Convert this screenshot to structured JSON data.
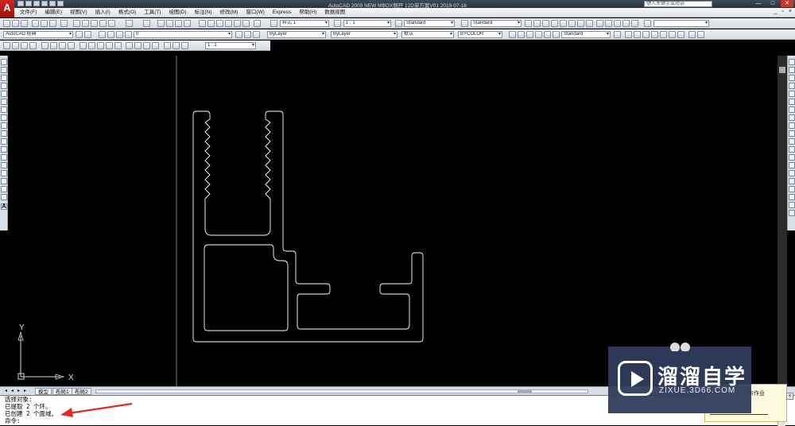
{
  "title_bar": {
    "window_title": "AutoCAD 2009  NEW MBOX侧开 12D单方案V01 2019-07-16",
    "search_placeholder": "键入关键字或短语",
    "minimize": "—",
    "maximize": "□",
    "close": "✕"
  },
  "menu": {
    "items": [
      "文件(F)",
      "编辑(E)",
      "视图(V)",
      "插入(I)",
      "格式(O)",
      "工具(T)",
      "绘图(D)",
      "标注(N)",
      "修改(M)",
      "窗口(W)",
      "Express",
      "帮助(H)",
      "数据视图"
    ],
    "mdi_minimize": "_",
    "mdi_restore": "▫",
    "mdi_close": "×"
  },
  "toolbars": {
    "dim_style": "样式 1",
    "scale": "1 : 1",
    "text_style": "Standard",
    "table_style": "Standard",
    "workspace": "AutoCAD 经典",
    "layer": "0",
    "color": "ByLayer",
    "linetype": "ByLayer",
    "lineweight": "默认",
    "plot_style": "BYCOLOR",
    "multileader_style": "Standard",
    "viewport_scale": "1 : 1"
  },
  "ucs": {
    "x_label": "X",
    "y_label": "Y"
  },
  "layout_tabs": {
    "model": "模型",
    "layout1": "布局1",
    "layout2": "布局2"
  },
  "command_line": {
    "lines": [
      "选择对象:",
      "已提取 2 个环。",
      "已创建 2 个面域。",
      "命令:"
    ]
  },
  "notification": {
    "title": "布作业",
    "link": "______________________"
  },
  "watermark": {
    "name": "溜溜自学",
    "domain": "ZIXUE.3D66.COM"
  },
  "colors": {
    "canvas": "#000000",
    "drawing_lines": "#ffffff",
    "annotation_arrow": "#e02a20",
    "autocad_red": "#c81e17"
  }
}
